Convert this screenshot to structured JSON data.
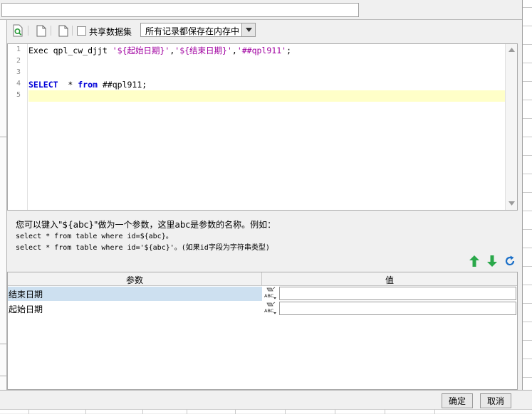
{
  "dataset_name": {
    "value": ""
  },
  "toolbar": {
    "share_dataset_label": "共享数据集",
    "share_dataset_checked": false,
    "storage_mode": "所有记录都保存在内存中"
  },
  "editor": {
    "line_numbers": [
      "1",
      "2",
      "3",
      "4",
      "5"
    ],
    "lines": [
      {
        "tokens": [
          {
            "t": "Exec qpl_cw_djjt ",
            "c": ""
          },
          {
            "t": "'${起始日期}'",
            "c": "str"
          },
          {
            "t": ",",
            "c": ""
          },
          {
            "t": "'${结束日期}'",
            "c": "str"
          },
          {
            "t": ",",
            "c": ""
          },
          {
            "t": "'##qpl911'",
            "c": "str"
          },
          {
            "t": ";",
            "c": ""
          }
        ]
      },
      {
        "tokens": []
      },
      {
        "tokens": []
      },
      {
        "tokens": [
          {
            "t": "SELECT",
            "c": "kw"
          },
          {
            "t": "  * ",
            "c": ""
          },
          {
            "t": "from",
            "c": "kw"
          },
          {
            "t": " ##qpl911;",
            "c": ""
          }
        ]
      },
      {
        "tokens": []
      }
    ],
    "active_line": 5
  },
  "help": {
    "line1": "您可以键入\"${abc}\"做为一个参数，这里abc是参数的名称。例如：",
    "line2": "select * from table where id=${abc}。",
    "line3": "select * from table where id='${abc}'。(如果id字段为字符串类型)"
  },
  "params": {
    "header_name": "参数",
    "header_value": "值",
    "rows": [
      {
        "name": "结束日期",
        "value": "",
        "selected": true
      },
      {
        "name": "起始日期",
        "value": "",
        "selected": false
      }
    ]
  },
  "buttons": {
    "ok": "确定",
    "cancel": "取消"
  },
  "icons": {
    "toolbar": [
      "refresh-preview-icon",
      "new-file-icon",
      "new-file-icon"
    ],
    "param_actions": [
      "move-up-icon",
      "move-down-icon",
      "refresh-icon"
    ],
    "type": "text-type-icon"
  },
  "colors": {
    "keyword": "#0000d8",
    "string": "#a000a0",
    "active_line": "#ffffc8",
    "selected_row": "#cde0f0",
    "arrow_green": "#2aa84a",
    "refresh_blue": "#1a6fc8"
  }
}
